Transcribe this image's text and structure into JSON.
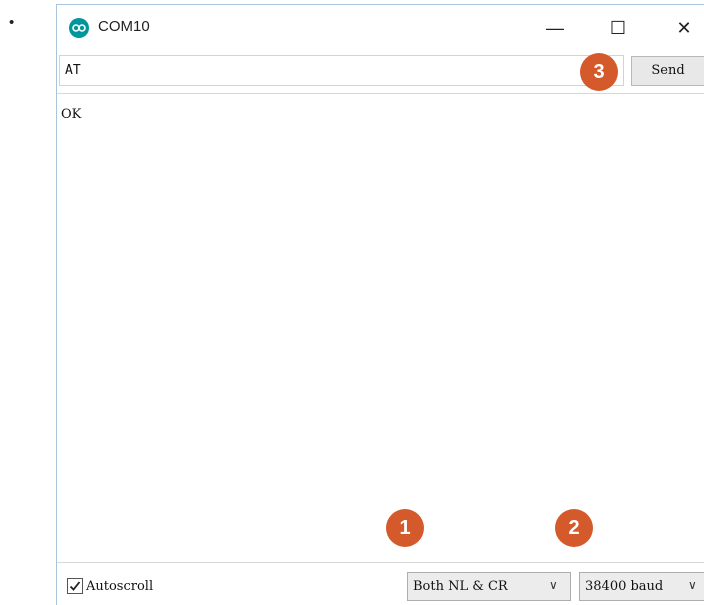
{
  "page": {
    "bullet": "•"
  },
  "window": {
    "title": "COM10",
    "app_icon": "arduino-infinity-icon",
    "controls": {
      "minimize_glyph": "—",
      "maximize_glyph": "☐",
      "close_glyph": "✕"
    }
  },
  "input": {
    "value": "AT",
    "send_label": "Send"
  },
  "output": {
    "lines": [
      "OK"
    ]
  },
  "statusbar": {
    "autoscroll_label": "Autoscroll",
    "autoscroll_checked": true,
    "line_ending": "Both NL & CR",
    "baud_rate": "38400 baud",
    "dropdown_glyph": "∨"
  },
  "callouts": {
    "one": "1",
    "two": "2",
    "three": "3",
    "color": "#d45a2c"
  },
  "colors": {
    "accent": "#00979c",
    "border": "#a9c4dc"
  }
}
